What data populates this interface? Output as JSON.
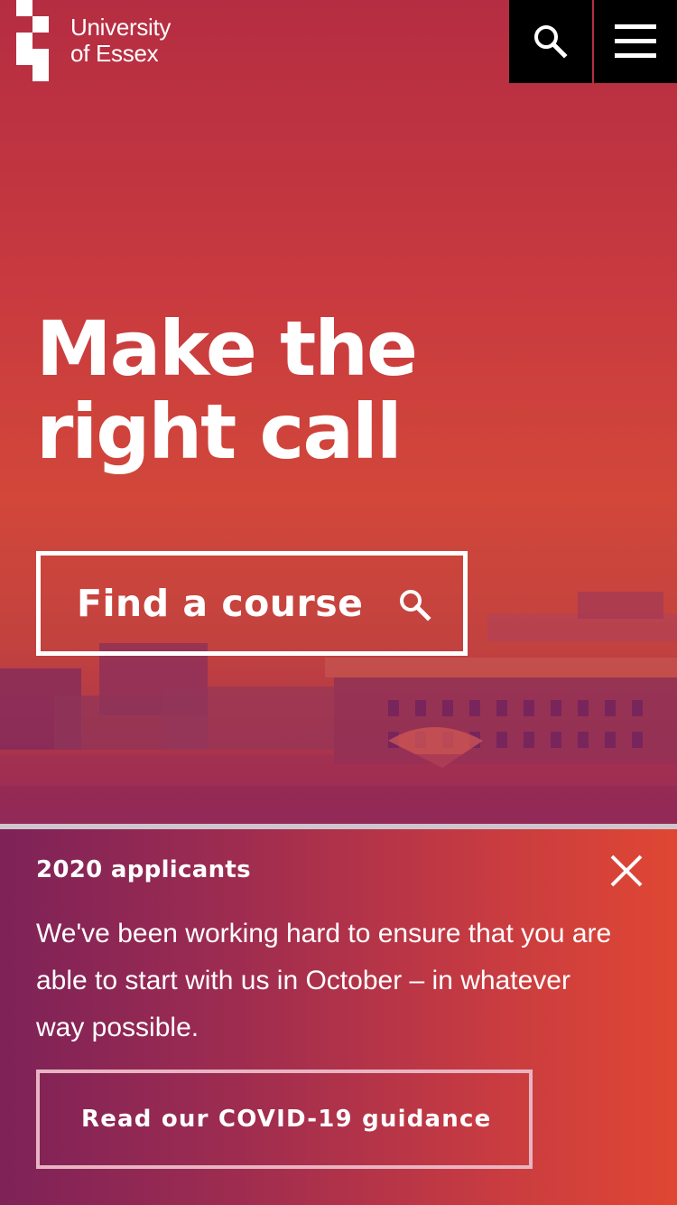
{
  "header": {
    "logo_line1": "University",
    "logo_line2": "of Essex",
    "search_icon": "search-icon",
    "menu_icon": "hamburger-menu-icon"
  },
  "hero": {
    "headline_line1": "Make the",
    "headline_line2": "right call",
    "find_course_label": "Find a course",
    "find_course_icon": "search-icon"
  },
  "notice": {
    "title": "2020 applicants",
    "body": "We've been working hard to ensure that you are able to start with us in October – in whatever way possible.",
    "cta_label": "Read our COVID-19 guidance",
    "close_icon": "close-icon"
  },
  "colors": {
    "hero_top": "#b52d42",
    "hero_mid": "#d2473a",
    "notice_left": "#7e2258",
    "notice_right": "#e04733",
    "header_buttons": "#000000"
  }
}
